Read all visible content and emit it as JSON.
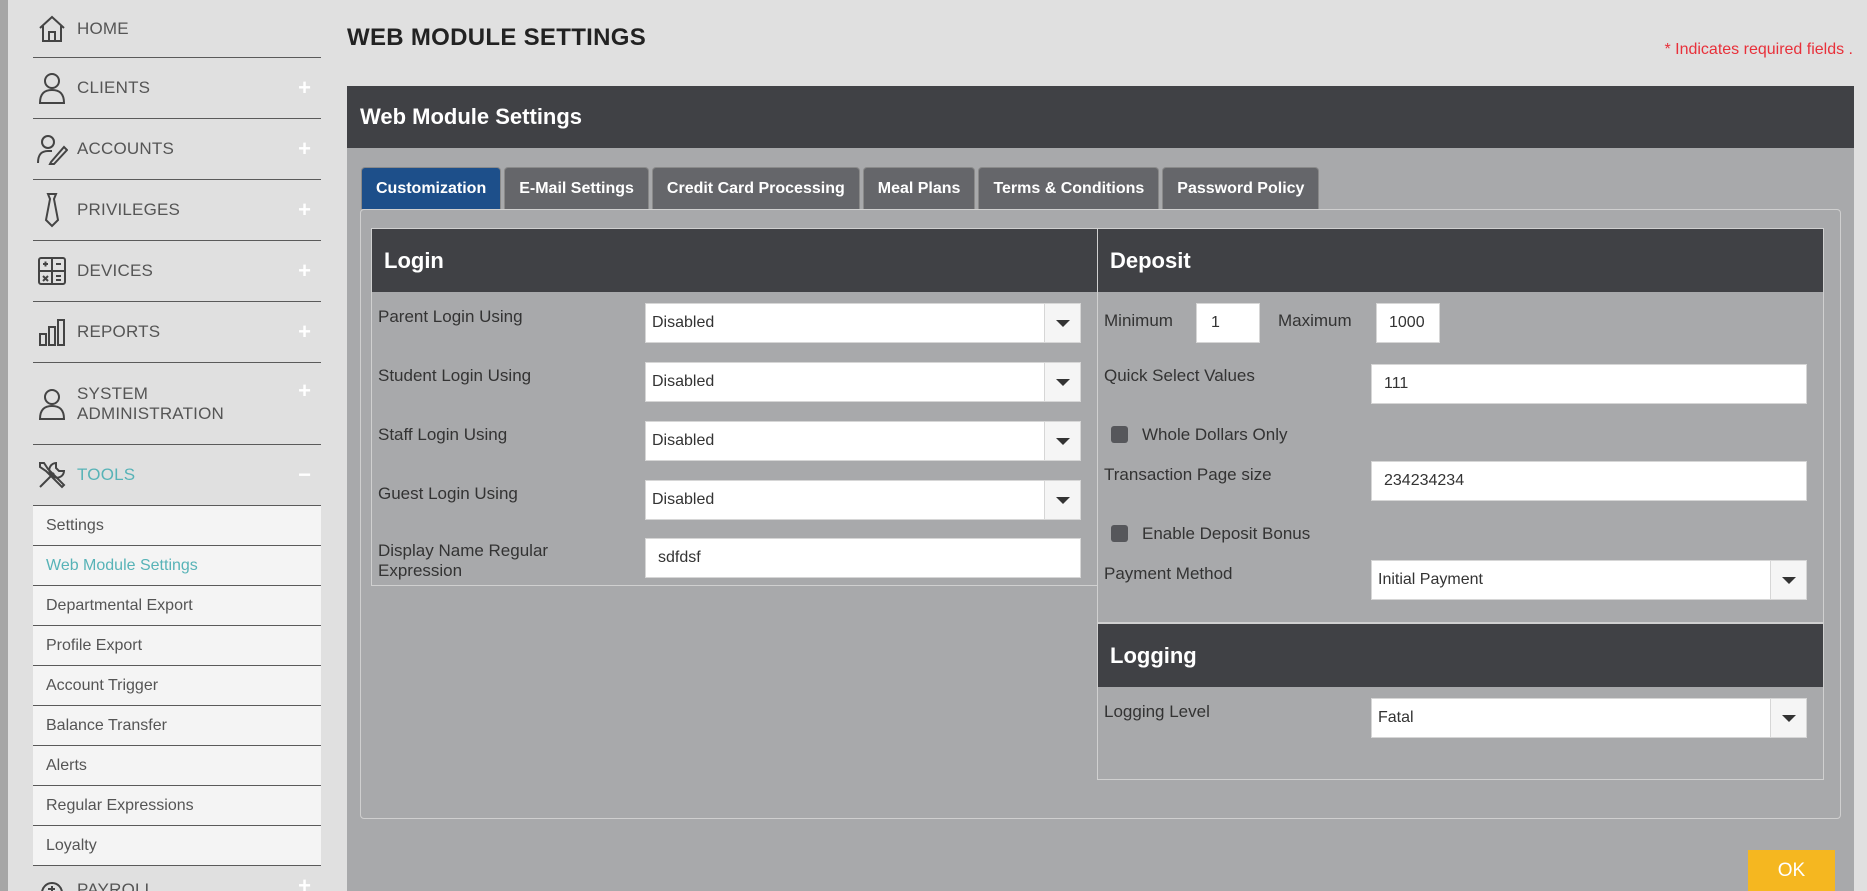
{
  "sidebar": {
    "items": [
      {
        "label": "HOME",
        "icon": "home-icon",
        "toggle": ""
      },
      {
        "label": "CLIENTS",
        "icon": "user-icon",
        "toggle": "+"
      },
      {
        "label": "ACCOUNTS",
        "icon": "edit-user-icon",
        "toggle": "+"
      },
      {
        "label": "PRIVILEGES",
        "icon": "tie-icon",
        "toggle": "+"
      },
      {
        "label": "DEVICES",
        "icon": "calculator-icon",
        "toggle": "+"
      },
      {
        "label": "REPORTS",
        "icon": "bar-chart-icon",
        "toggle": "+"
      },
      {
        "label": "SYSTEM ADMINISTRATION",
        "icon": "admin-user-icon",
        "toggle": "+"
      },
      {
        "label": "TOOLS",
        "icon": "tools-icon",
        "toggle": "−"
      }
    ],
    "tools_subitems": [
      "Settings",
      "Web Module Settings",
      "Departmental Export",
      "Profile Export",
      "Account Trigger",
      "Balance Transfer",
      "Alerts",
      "Regular Expressions",
      "Loyalty"
    ],
    "active_subitem": "Web Module Settings",
    "payroll": {
      "label": "PAYROLL",
      "toggle": "+"
    }
  },
  "page": {
    "title": "WEB MODULE SETTINGS",
    "required_note": "* Indicates required fields ."
  },
  "panel": {
    "title": "Web Module Settings",
    "tabs": [
      "Customization",
      "E-Mail Settings",
      "Credit Card Processing",
      "Meal Plans",
      "Terms & Conditions",
      "Password Policy"
    ],
    "active_tab": "Customization"
  },
  "login": {
    "title": "Login",
    "parent_label": "Parent Login Using",
    "parent_value": "Disabled",
    "student_label": "Student Login Using",
    "student_value": "Disabled",
    "staff_label": "Staff Login Using",
    "staff_value": "Disabled",
    "guest_label": "Guest Login Using",
    "guest_value": "Disabled",
    "display_regex_label": "Display Name Regular Expression",
    "display_regex_value": "sdfdsf"
  },
  "deposit": {
    "title": "Deposit",
    "min_label": "Minimum",
    "min_value": "1",
    "max_label": "Maximum",
    "max_value": "1000",
    "quick_label": "Quick Select Values",
    "quick_value": "111",
    "whole_dollars_label": "Whole Dollars Only",
    "whole_dollars_checked": false,
    "page_size_label": "Transaction Page size",
    "page_size_value": "234234234",
    "bonus_label": "Enable Deposit Bonus",
    "bonus_checked": false,
    "payment_label": "Payment Method",
    "payment_value": "Initial Payment"
  },
  "logging": {
    "title": "Logging",
    "level_label": "Logging Level",
    "level_value": "Fatal"
  },
  "actions": {
    "ok_label": "OK"
  },
  "colors": {
    "accent_teal": "#57b3b7",
    "tab_active": "#1d4f8a",
    "ok_button": "#f5b720",
    "required": "#e8303a",
    "header_dark": "#404145"
  }
}
